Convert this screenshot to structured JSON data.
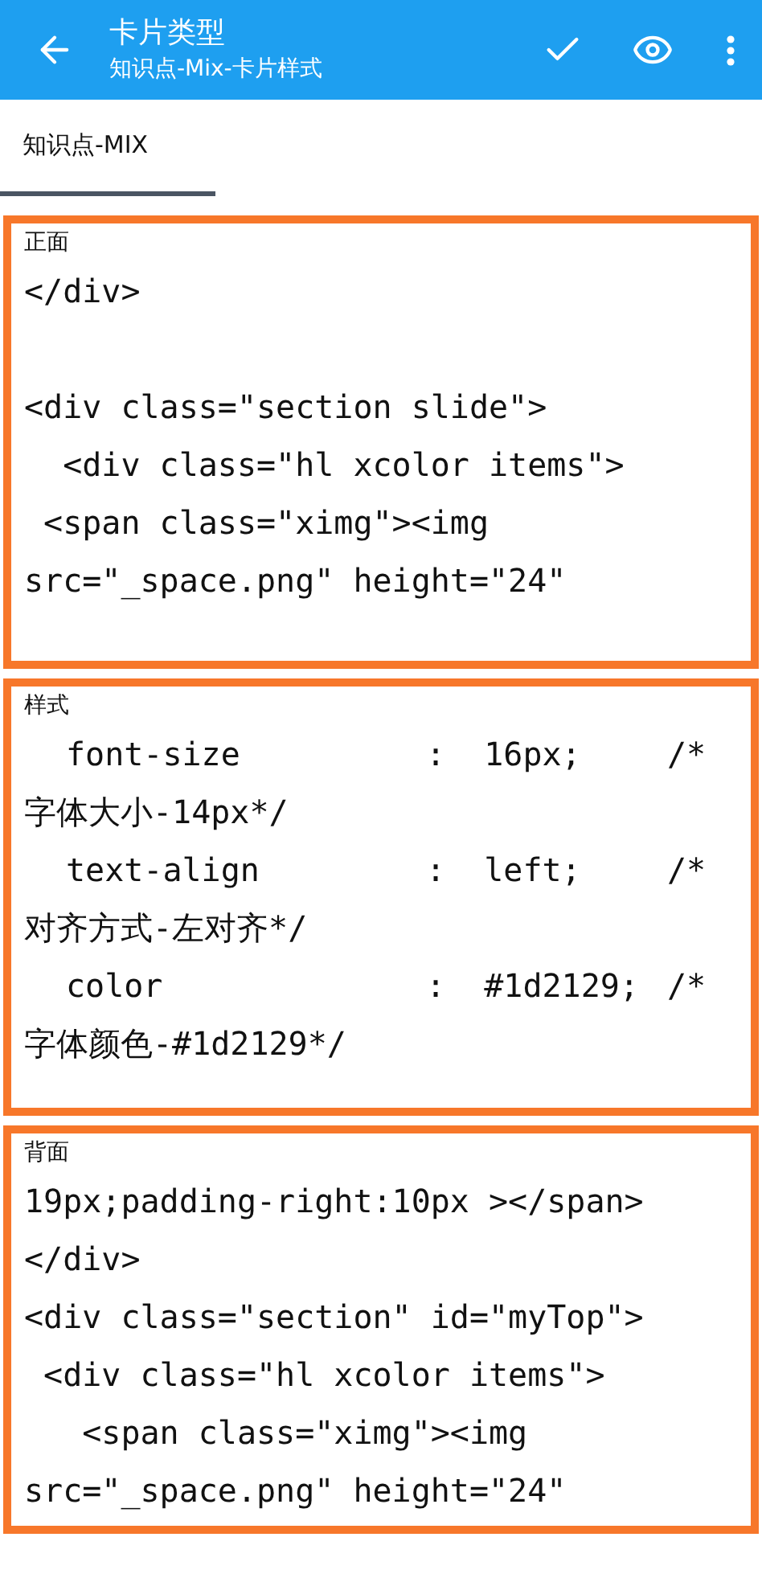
{
  "app_bar": {
    "title": "卡片类型",
    "subtitle": "知识点-Mix-卡片样式"
  },
  "tabs": [
    {
      "label": "知识点-MIX",
      "selected": true
    }
  ],
  "sections": [
    {
      "label": "正面",
      "lines": [
        {
          "kind": "text",
          "text": "</div>"
        },
        {
          "kind": "text",
          "text": "<div class=\"section slide\">",
          "gap_before": true
        },
        {
          "kind": "text",
          "text": "  <div class=\"hl xcolor items\">"
        },
        {
          "kind": "text",
          "text": " <span class=\"ximg\"><img"
        },
        {
          "kind": "text",
          "text": "src=\"_space.png\" height=\"24\""
        }
      ]
    },
    {
      "label": "样式",
      "lines": [
        {
          "kind": "decl",
          "property": "font-size",
          "value": ":  16px;",
          "comment": "/*"
        },
        {
          "kind": "text",
          "text": "字体大小-14px*/"
        },
        {
          "kind": "decl",
          "property": "text-align",
          "value": ":  left;",
          "comment": "/*"
        },
        {
          "kind": "text",
          "text": "对齐方式-左对齐*/"
        },
        {
          "kind": "decl",
          "property": "color",
          "value": ":  #1d2129;",
          "comment": "/*"
        },
        {
          "kind": "text",
          "text": "字体颜色-#1d2129*/"
        }
      ]
    },
    {
      "label": "背面",
      "lines": [
        {
          "kind": "text",
          "text": "19px;padding-right:10px ></span>"
        },
        {
          "kind": "text",
          "text": "</div>"
        },
        {
          "kind": "text",
          "text": "<div class=\"section\" id=\"myTop\">"
        },
        {
          "kind": "text",
          "text": " <div class=\"hl xcolor items\">"
        },
        {
          "kind": "text",
          "text": "   <span class=\"ximg\"><img"
        },
        {
          "kind": "text",
          "text": "src=\"_space.png\" height=\"24\""
        }
      ]
    }
  ]
}
